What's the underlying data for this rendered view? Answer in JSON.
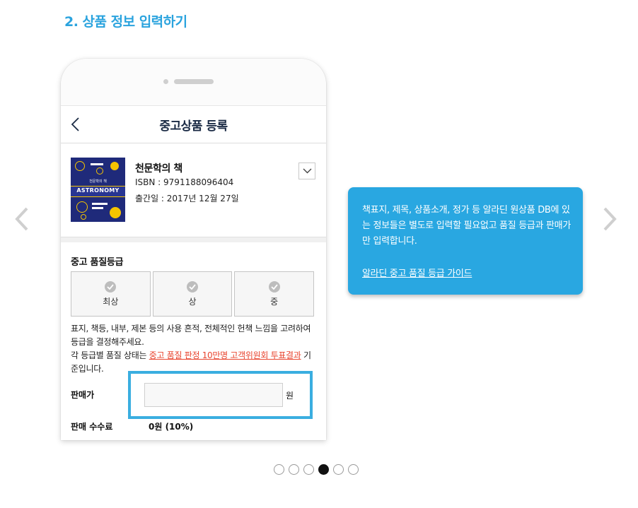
{
  "section": {
    "title": "2. 상품 정보 입력하기"
  },
  "carousel": {
    "prev_icon": "chevron-left-icon",
    "next_icon": "chevron-right-icon",
    "dots": [
      {
        "active": false
      },
      {
        "active": false
      },
      {
        "active": false
      },
      {
        "active": true
      },
      {
        "active": false
      },
      {
        "active": false
      }
    ]
  },
  "app": {
    "title": "중고상품 등록",
    "back_icon": "chevron-left-icon"
  },
  "product": {
    "cover_title_small": "천문학의 책",
    "cover_band": "ASTRONOMY",
    "title": "천문학의 책",
    "isbn": "ISBN : 9791188096404",
    "date": "출간일 : 2017년 12월 27일",
    "expand_icon": "chevron-down-icon"
  },
  "grade": {
    "label": "중고 품질등급",
    "options": [
      {
        "label": "최상",
        "icon": "check-circle-icon"
      },
      {
        "label": "상",
        "icon": "check-circle-icon"
      },
      {
        "label": "중",
        "icon": "check-circle-icon"
      }
    ],
    "desc_line1": "표지, 책등, 내부, 제본 등의 사용 흔적, 전체적인 헌책 느낌을 고려하여 등급을 결정해주세요.",
    "desc_line2_prefix": "각 등급별 품질 상태는 ",
    "desc_link": "중고 품질 판정 10만명 고객위원회 투표결과",
    "desc_line2_suffix": " 기준입니다."
  },
  "price": {
    "label": "판매가",
    "value": "",
    "placeholder": "",
    "unit": "원"
  },
  "fee": {
    "label": "판매 수수료",
    "value": "0원 (10%)"
  },
  "tooltip": {
    "text": "책표지, 제목, 상품소개, 정가 등 알라딘 원상품 DB에 있는 정보들은 별도로 입력할 필요없고 품질 등급과 판매가만 입력합니다.",
    "link": "알라딘 중고 품질 등급 가이드"
  },
  "colors": {
    "accent": "#2aa3de",
    "tooltip_bg": "#29a7e1",
    "highlight": "#3aaee0",
    "link_red": "#e8442e"
  }
}
